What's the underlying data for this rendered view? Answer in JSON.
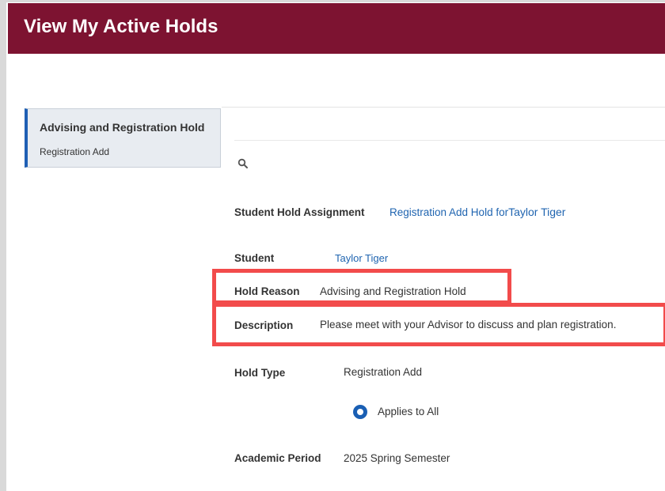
{
  "header": {
    "title": "View My Active Holds"
  },
  "sidebar": {
    "card": {
      "title": "Advising and Registration Hold",
      "subtitle": "Registration Add"
    }
  },
  "details": {
    "student_hold_assignment": {
      "label": "Student Hold Assignment",
      "link_text": "Registration Add Hold for",
      "link_name": "Taylor Tiger"
    },
    "student": {
      "label": "Student",
      "value": "Taylor Tiger"
    },
    "hold_reason": {
      "label": "Hold Reason",
      "value": "Advising and Registration Hold"
    },
    "description": {
      "label": "Description",
      "value": "Please meet with your Advisor to discuss and plan registration."
    },
    "hold_type": {
      "label": "Hold Type",
      "value": "Registration Add"
    },
    "applies": {
      "label": "Applies to All",
      "selected": true
    },
    "academic_period": {
      "label": "Academic Period",
      "value": "2025 Spring Semester"
    }
  },
  "colors": {
    "header_bg": "#7d1331",
    "link": "#1f64b0",
    "highlight": "#f24b4b",
    "accent": "#1f5fb4"
  }
}
